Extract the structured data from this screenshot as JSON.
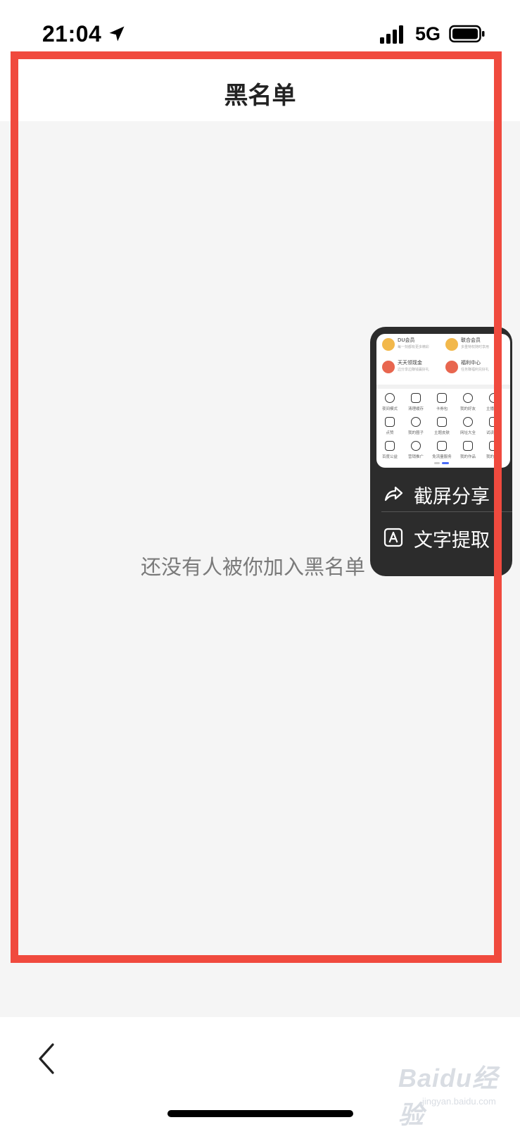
{
  "status_bar": {
    "time": "21:04",
    "network": "5G",
    "icons": [
      "location-arrow-icon",
      "signal-bars-icon",
      "battery-icon"
    ]
  },
  "header": {
    "title": "黑名单"
  },
  "content": {
    "empty_message": "还没有人被你加入黑名单"
  },
  "screenshot_popup": {
    "thumbnail": {
      "cards": [
        {
          "title": "DU会员",
          "subtitle": "每一刻都有更多精彩",
          "color": "#f2b84b"
        },
        {
          "title": "联合会员",
          "subtitle": "多重特权随时享用",
          "color": "#f2b84b"
        },
        {
          "title": "天天领现金",
          "subtitle": "边分享边赚钱赢好礼",
          "color": "#e8664f"
        },
        {
          "title": "福利中心",
          "subtitle": "任务赚福利兑好礼",
          "color": "#e8664f"
        }
      ],
      "grid": [
        "夜间模式",
        "清理缓存",
        "卡券包",
        "我的好友",
        "主播中心",
        "点赞",
        "我的圈子",
        "主题皮肤",
        "网址大全",
        "试读中心",
        "百度公益",
        "营销推广",
        "免流量服务",
        "我的作品",
        "我的书架"
      ]
    },
    "actions": [
      {
        "label": "截屏分享",
        "icon": "share-arrow-icon"
      },
      {
        "label": "文字提取",
        "icon": "text-extract-icon"
      }
    ]
  },
  "bottom_bar": {
    "back_icon": "chevron-left-icon"
  },
  "watermark": {
    "text": "Baidu经验",
    "sub": "jingyan.baidu.com"
  },
  "colors": {
    "highlight": "#f04a3e",
    "content_bg": "#f5f5f5",
    "popup_bg": "#2c2c2c"
  }
}
